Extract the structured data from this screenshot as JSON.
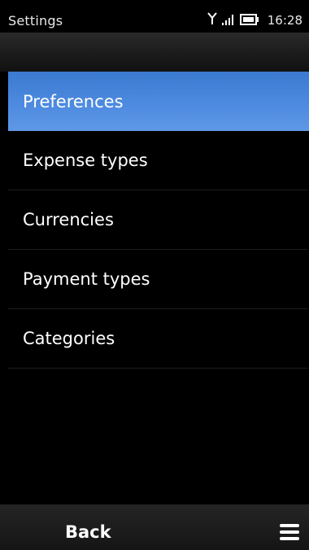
{
  "status_bar": {
    "title": "Settings",
    "time": "16:28"
  },
  "menu": {
    "items": [
      {
        "label": "Preferences",
        "selected": true
      },
      {
        "label": "Expense types",
        "selected": false
      },
      {
        "label": "Currencies",
        "selected": false
      },
      {
        "label": "Payment types",
        "selected": false
      },
      {
        "label": "Categories",
        "selected": false
      }
    ]
  },
  "toolbar": {
    "back_label": "Back",
    "options_icon": "menu-icon"
  },
  "colors": {
    "selection": "#4d8ae0",
    "background": "#000000"
  }
}
